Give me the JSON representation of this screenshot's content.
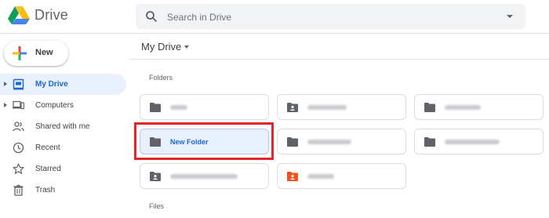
{
  "header": {
    "app_name": "Drive",
    "search": {
      "placeholder": "Search in Drive",
      "value": ""
    }
  },
  "new_button": {
    "label": "New"
  },
  "sidebar": {
    "items": [
      {
        "label": "My Drive",
        "icon": "my-drive-icon",
        "expandable": true,
        "active": true
      },
      {
        "label": "Computers",
        "icon": "computers-icon",
        "expandable": true,
        "active": false
      },
      {
        "label": "Shared with me",
        "icon": "shared-with-me-icon",
        "expandable": false,
        "active": false
      },
      {
        "label": "Recent",
        "icon": "clock-icon",
        "expandable": false,
        "active": false
      },
      {
        "label": "Starred",
        "icon": "star-icon",
        "expandable": false,
        "active": false
      },
      {
        "label": "Trash",
        "icon": "trash-icon",
        "expandable": false,
        "active": false
      }
    ]
  },
  "main": {
    "title": "My Drive",
    "folders_label": "Folders",
    "files_label": "Files",
    "folders": [
      {
        "name": "",
        "icon": "folder-icon",
        "obscured": true
      },
      {
        "name": "",
        "icon": "shared-folder-icon",
        "obscured": true
      },
      {
        "name": "",
        "icon": "folder-icon",
        "obscured": true
      },
      {
        "name": "New Folder",
        "icon": "folder-icon",
        "obscured": false,
        "selected": true
      },
      {
        "name": "",
        "icon": "folder-icon",
        "obscured": true
      },
      {
        "name": "",
        "icon": "folder-icon",
        "obscured": true
      },
      {
        "name": "",
        "icon": "shared-folder-icon",
        "obscured": true
      },
      {
        "name": "",
        "icon": "shared-folder-icon",
        "obscured": true,
        "color": "#f4511e"
      }
    ]
  },
  "colors": {
    "accent": "#1967d2",
    "selected_bg": "#e8f0fe",
    "highlight": "#e0262b"
  }
}
